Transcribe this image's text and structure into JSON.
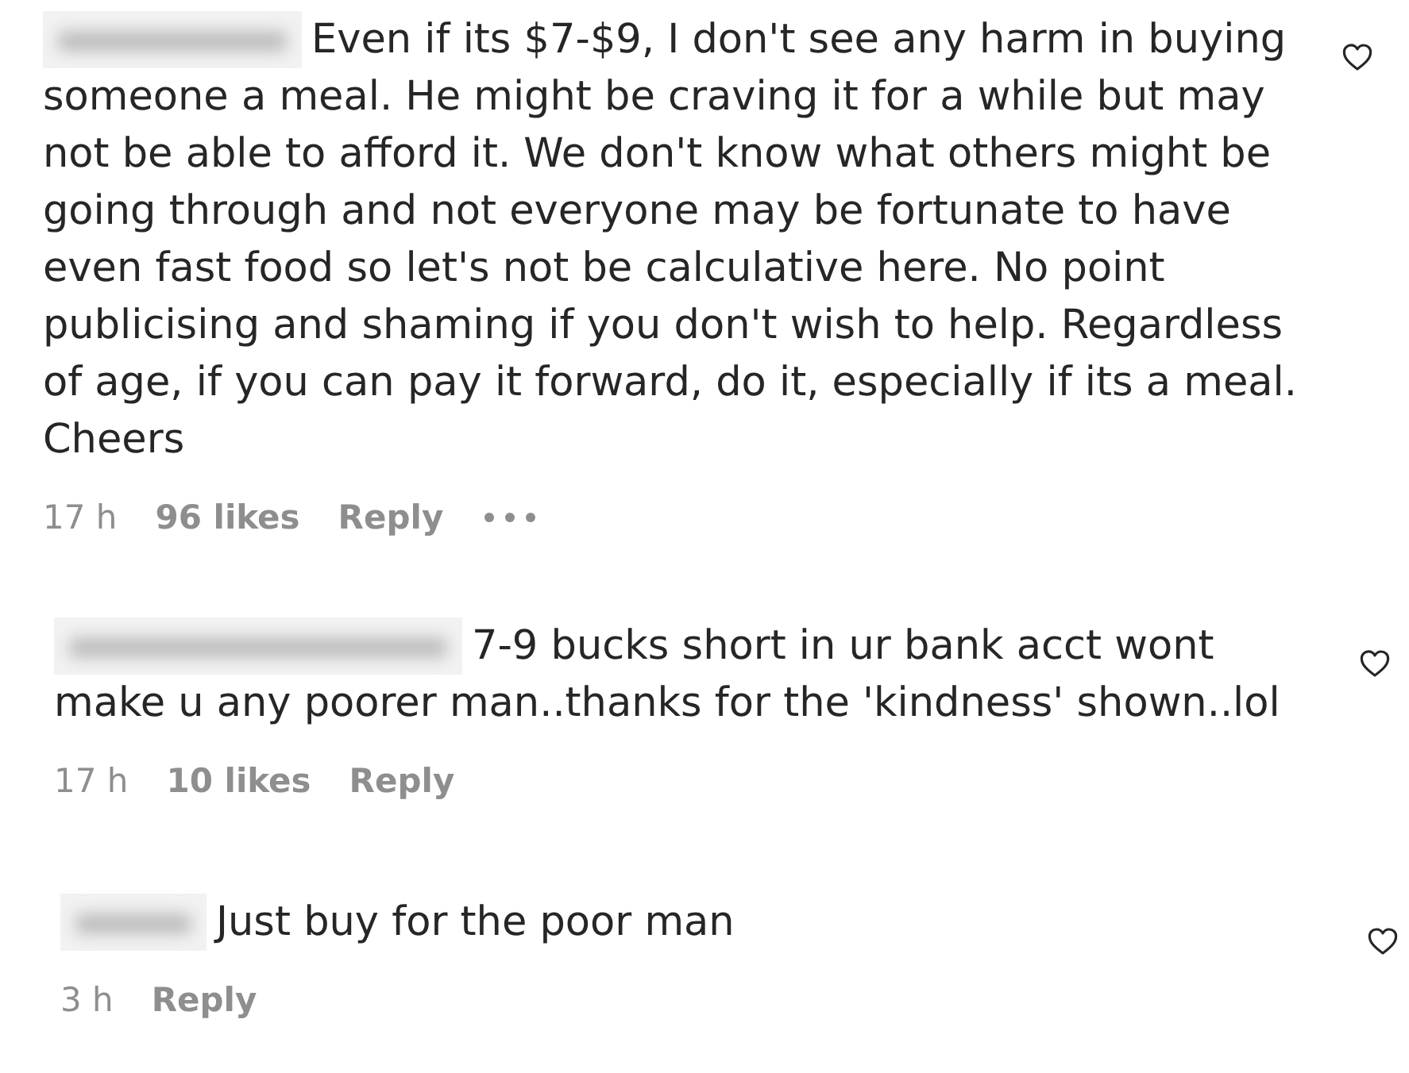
{
  "comments": [
    {
      "text": "Even if its $7-$9, I don't see any harm in buying someone a meal. He might be craving it for a while but may not be able to afford it. We don't know what others might be going through and not everyone may be fortunate to have even fast food so let's not be calculative here. No point publicising and shaming if you don't wish to help. Regardless of age, if you can pay it forward, do it, especially if its a meal. Cheers",
      "liked": false,
      "time": "17 h",
      "likes": "96 likes",
      "reply": "Reply",
      "more_options": true
    },
    {
      "text": "7-9 bucks short in ur bank acct wont make u any poorer man..thanks for the 'kindness' shown..lol",
      "liked": false,
      "time": "17 h",
      "likes": "10 likes",
      "reply": "Reply",
      "more_options": false
    },
    {
      "text": "Just buy for the poor man",
      "liked": false,
      "time": "3 h",
      "reply": "Reply",
      "more_options": false
    }
  ]
}
